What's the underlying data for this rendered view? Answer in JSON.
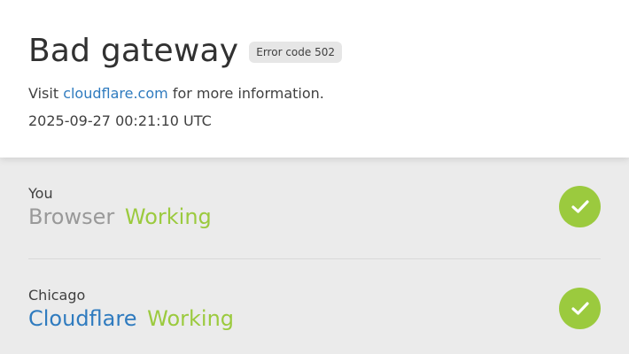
{
  "header": {
    "title": "Bad gateway",
    "error_badge": "Error code 502",
    "visit_prefix": "Visit",
    "visit_link": "cloudflare.com",
    "visit_suffix": "for more information.",
    "timestamp": "2025-09-27 00:21:10 UTC"
  },
  "nodes": [
    {
      "location": "You",
      "name": "Browser",
      "status": "Working",
      "icon": "check-circle-icon"
    },
    {
      "location": "Chicago",
      "name": "Cloudflare",
      "status": "Working",
      "icon": "check-circle-icon"
    }
  ],
  "colors": {
    "accent_link": "#2f7bbf",
    "working_green": "#9bca3e",
    "status_background": "#ebebeb"
  }
}
